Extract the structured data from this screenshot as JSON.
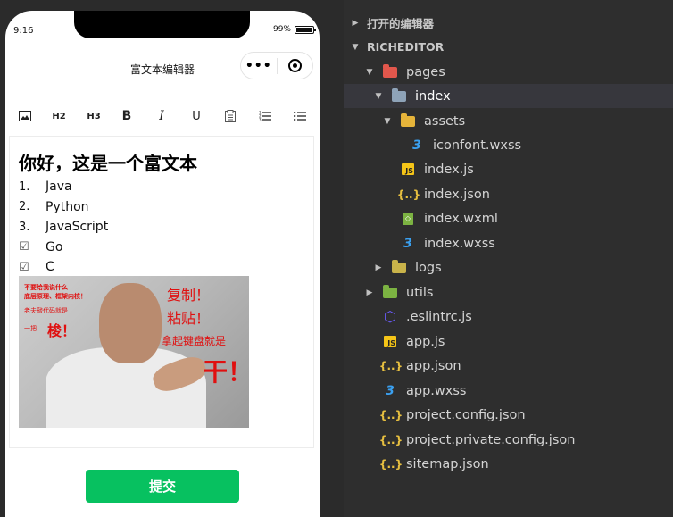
{
  "phone": {
    "time": "9:16",
    "battery": "99%",
    "nav_title": "富文本编辑器",
    "capsule_menu": "•••",
    "toolbar": [
      {
        "name": "image-icon",
        "label": "▣"
      },
      {
        "name": "h2-button",
        "label": "H2"
      },
      {
        "name": "h3-button",
        "label": "H3"
      },
      {
        "name": "bold-button",
        "label": "B"
      },
      {
        "name": "italic-button",
        "label": "I"
      },
      {
        "name": "underline-button",
        "label": "U"
      },
      {
        "name": "clipboard-icon",
        "label": "▤"
      },
      {
        "name": "ordered-list-icon",
        "label": "☰"
      },
      {
        "name": "bullet-list-icon",
        "label": "☰"
      }
    ],
    "editor": {
      "title": "你好，这是一个富文本",
      "items": [
        {
          "mark": "1.",
          "text": "Java"
        },
        {
          "mark": "2.",
          "text": "Python"
        },
        {
          "mark": "3.",
          "text": "JavaScript"
        },
        {
          "mark": "☑",
          "text": "Go"
        },
        {
          "mark": "☑",
          "text": "C"
        }
      ],
      "image_texts": {
        "t1": "不要给我说什么",
        "t2": "底层原理、框架内核！",
        "t3": "老夫敲代码就是",
        "t4": "一把",
        "t5": "梭！",
        "t6": "复制！",
        "t7": "粘贴！",
        "t8": "拿起键盘就是",
        "t9": "干！"
      }
    },
    "submit_label": "提交"
  },
  "explorer": {
    "open_editors": "打开的编辑器",
    "project": "RICHEDITOR",
    "tree": [
      {
        "label": "pages",
        "type": "folder-red"
      },
      {
        "label": "index",
        "type": "folder-blue"
      },
      {
        "label": "assets",
        "type": "folder-yellow"
      },
      {
        "label": "iconfont.wxss",
        "type": "css"
      },
      {
        "label": "index.js",
        "type": "js"
      },
      {
        "label": "index.json",
        "type": "json"
      },
      {
        "label": "index.wxml",
        "type": "wxml"
      },
      {
        "label": "index.wxss",
        "type": "css"
      },
      {
        "label": "logs",
        "type": "folder-yellow"
      },
      {
        "label": "utils",
        "type": "folder-green"
      },
      {
        "label": ".eslintrc.js",
        "type": "eslint"
      },
      {
        "label": "app.js",
        "type": "js"
      },
      {
        "label": "app.json",
        "type": "json"
      },
      {
        "label": "app.wxss",
        "type": "css"
      },
      {
        "label": "project.config.json",
        "type": "json"
      },
      {
        "label": "project.private.config.json",
        "type": "json"
      },
      {
        "label": "sitemap.json",
        "type": "json"
      }
    ]
  }
}
